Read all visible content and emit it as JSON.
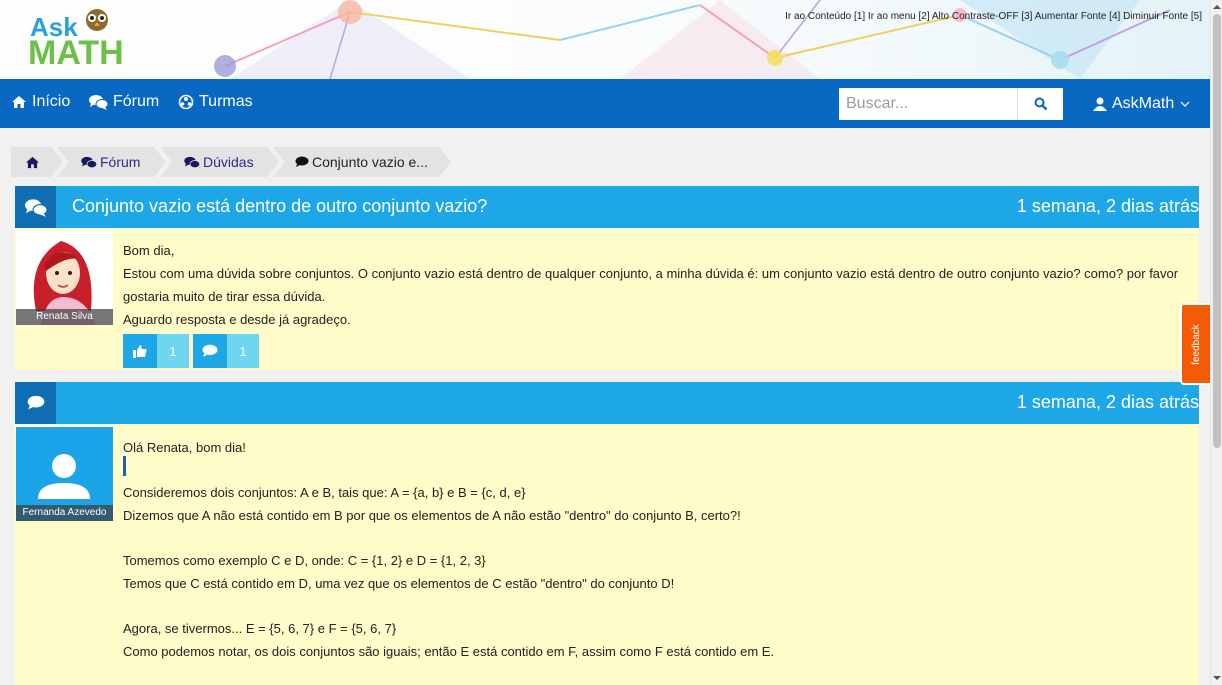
{
  "header": {
    "logo": {
      "line1": "Ask",
      "line2": "MATH"
    },
    "accessibility_links": [
      "Ir ao Conteúdo [1]",
      "Ir ao menu [2]",
      "Alto Contraste-OFF [3]",
      "Aumentar Fonte [4]",
      "Diminuir Fonte [5]"
    ]
  },
  "nav": {
    "items": [
      {
        "label": "Início",
        "icon": "home-icon"
      },
      {
        "label": "Fórum",
        "icon": "comments-icon"
      },
      {
        "label": "Turmas",
        "icon": "turmas-icon"
      }
    ],
    "search_placeholder": "Buscar...",
    "user_label": "AskMath"
  },
  "breadcrumb": {
    "items": [
      "Fórum",
      "Dúvidas",
      "Conjunto vazio e..."
    ]
  },
  "question": {
    "title": "Conjunto vazio está dentro de outro conjunto vazio?",
    "time": "1 semana, 2 dias atrás",
    "author": "Renata Silva",
    "lines": [
      "Bom dia,",
      "Estou com uma dúvida sobre conjuntos. O conjunto vazio está dentro de qualquer conjunto, a minha dúvida é: um conjunto vazio está dentro de outro conjunto vazio? como? por favor gostaria muito de tirar essa dúvida.",
      "Aguardo resposta e desde já agradeço."
    ],
    "likes": "1",
    "comments": "1"
  },
  "answer": {
    "time": "1 semana, 2 dias atrás",
    "author": "Fernanda Azevedo",
    "lines": [
      "Olá Renata, bom dia!",
      "",
      "Consideremos dois conjuntos: A e B, tais que: A = {a, b} e B = {c, d, e}",
      "Dizemos que A não está contido em B por que os elementos de A não estão \"dentro\" do conjunto B, certo?!",
      "",
      "Tomemos como exemplo C e D, onde: C = {1, 2} e D = {1, 2, 3}",
      "Temos que C está contido em D, uma vez que os elementos de C estão \"dentro\" do conjunto D!",
      "",
      "Agora, se tivermos... E = {5, 6, 7} e F = {5, 6, 7}",
      "Como podemos notar, os dois conjuntos são iguais; então E está contido em F, assim como F está contido em E."
    ]
  },
  "feedback_label": "feedback",
  "colors": {
    "navbar": "#0969c2",
    "post_header": "#1ea7e6",
    "post_icon_bg": "#0f6eb3",
    "post_body": "#fffcc9",
    "feedback": "#f35b06"
  }
}
